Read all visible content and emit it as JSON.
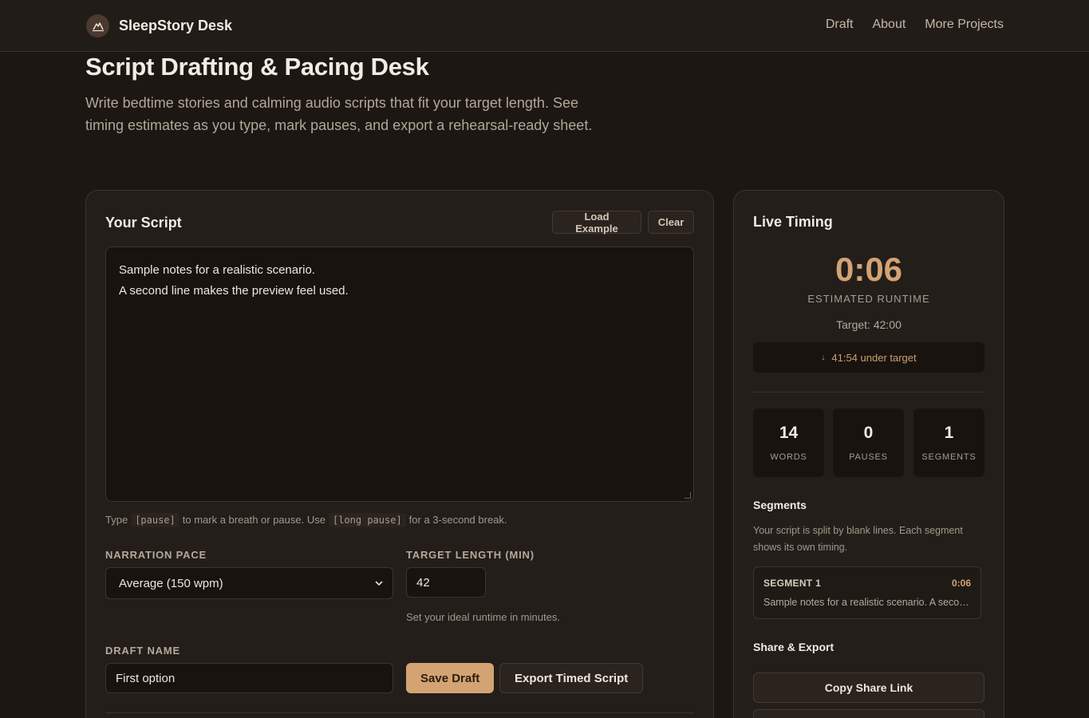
{
  "brand": {
    "name": "SleepStory Desk",
    "logo_icon": "moon-mountain-icon"
  },
  "nav": {
    "items": [
      "Draft",
      "About",
      "More Projects"
    ]
  },
  "hero": {
    "title": "Script Drafting & Pacing Desk",
    "subtitle": "Write bedtime stories and calming audio scripts that fit your target length. See timing estimates as you type, mark pauses, and export a rehearsal-ready sheet."
  },
  "editor": {
    "title": "Your Script",
    "load_example_label": "Load Example",
    "clear_label": "Clear",
    "script_lines": [
      "Sample notes for a realistic scenario.",
      "A second line makes the preview feel used."
    ],
    "hint": {
      "part1": "Type",
      "code1": "[pause]",
      "part2": "to mark a breath or pause. Use",
      "code2": "[long pause]",
      "part3": "for a 3-second break."
    },
    "pace": {
      "label": "NARRATION PACE",
      "value": "Average (150 wpm)"
    },
    "target": {
      "label": "TARGET LENGTH (MIN)",
      "value": "42",
      "helper": "Set your ideal runtime in minutes."
    },
    "draft": {
      "label": "DRAFT NAME",
      "value": "First option"
    },
    "save_label": "Save Draft",
    "export_label": "Export Timed Script"
  },
  "timing": {
    "title": "Live Timing",
    "runtime": "0:06",
    "runtime_label": "ESTIMATED RUNTIME",
    "target_text": "Target: 42:00",
    "status_arrow": "↓",
    "status_text": "41:54 under target",
    "stats": [
      {
        "value": "14",
        "label": "WORDS"
      },
      {
        "value": "0",
        "label": "PAUSES"
      },
      {
        "value": "1",
        "label": "SEGMENTS"
      }
    ],
    "segments_title": "Segments",
    "segments_help": "Your script is split by blank lines. Each segment shows its own timing.",
    "segments": [
      {
        "name": "SEGMENT 1",
        "time": "0:06",
        "preview": "Sample notes for a realistic scenario. A second line makes the preview feel used."
      }
    ],
    "share_title": "Share & Export",
    "copy_link_label": "Copy Share Link"
  },
  "colors": {
    "accent": "#d4a373",
    "background": "#1c1713",
    "panel": "#231e1a"
  }
}
